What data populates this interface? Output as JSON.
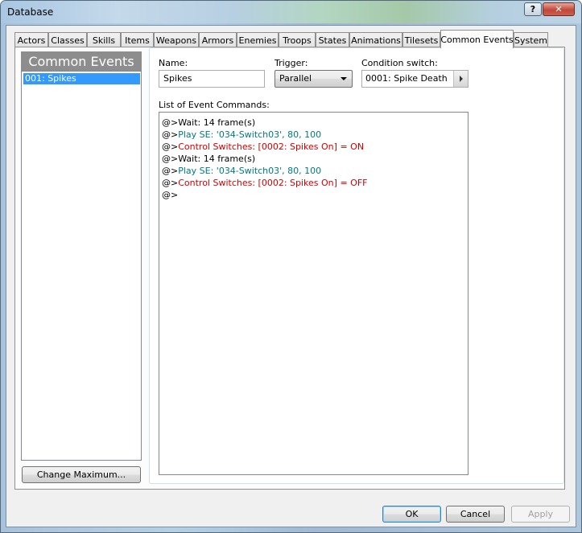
{
  "window": {
    "title": "Database",
    "help_label": "?",
    "close_label": "✕"
  },
  "tabs": [
    {
      "label": "Actors"
    },
    {
      "label": "Classes"
    },
    {
      "label": "Skills"
    },
    {
      "label": "Items"
    },
    {
      "label": "Weapons"
    },
    {
      "label": "Armors"
    },
    {
      "label": "Enemies"
    },
    {
      "label": "Troops"
    },
    {
      "label": "States"
    },
    {
      "label": "Animations"
    },
    {
      "label": "Tilesets"
    },
    {
      "label": "Common Events",
      "active": true
    },
    {
      "label": "System"
    }
  ],
  "left": {
    "header": "Common Events",
    "items": [
      {
        "label": "001: Spikes",
        "selected": true
      }
    ],
    "change_max_label": "Change Maximum..."
  },
  "form": {
    "name_label": "Name:",
    "name_value": "Spikes",
    "trigger_label": "Trigger:",
    "trigger_value": "Parallel",
    "condition_label": "Condition switch:",
    "condition_value": "0001: Spike Death",
    "commands_label": "List of Event Commands:"
  },
  "commands": [
    {
      "prefix": "@>",
      "text": "Wait: 14 frame(s)",
      "color": "#000000"
    },
    {
      "prefix": "@>",
      "text": "Play SE: '034-Switch03', 80, 100",
      "color": "#007a80"
    },
    {
      "prefix": "@>",
      "text": "Control Switches: [0002: Spikes On] = ON",
      "color": "#d40000"
    },
    {
      "prefix": "@>",
      "text": "Wait: 14 frame(s)",
      "color": "#000000"
    },
    {
      "prefix": "@>",
      "text": "Play SE: '034-Switch03', 80, 100",
      "color": "#007a80"
    },
    {
      "prefix": "@>",
      "text": "Control Switches: [0002: Spikes On] = OFF",
      "color": "#d40000"
    },
    {
      "prefix": "@>",
      "text": "",
      "color": "#000000"
    }
  ],
  "buttons": {
    "ok": "OK",
    "cancel": "Cancel",
    "apply": "Apply"
  }
}
